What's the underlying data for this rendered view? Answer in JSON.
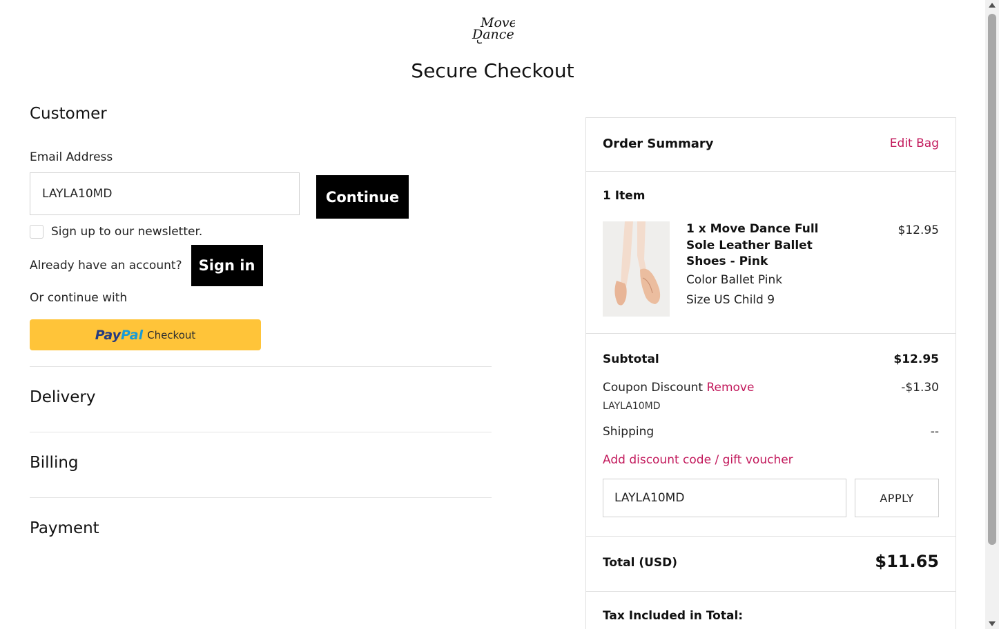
{
  "brand": {
    "logo_top": "Move",
    "logo_bottom": "Dance"
  },
  "page": {
    "title": "Secure Checkout"
  },
  "customer": {
    "heading": "Customer",
    "email_label": "Email Address",
    "email_value": "LAYLA10MD",
    "continue_label": "Continue",
    "newsletter_label": "Sign up to our newsletter.",
    "newsletter_checked": false,
    "account_prompt": "Already have an account?",
    "signin_label": "Sign in",
    "or_text": "Or continue with",
    "paypal": {
      "pay": "Pay",
      "pal": "Pal",
      "checkout": "Checkout",
      "bg_color": "#ffc439"
    }
  },
  "sections": [
    {
      "label": "Delivery"
    },
    {
      "label": "Billing"
    },
    {
      "label": "Payment"
    }
  ],
  "summary": {
    "title": "Order Summary",
    "edit_label": "Edit Bag",
    "item_count": "1 Item",
    "item": {
      "name": "1 x Move Dance Full Sole Leather Ballet Shoes - Pink",
      "color": "Color Ballet Pink",
      "size": "Size US Child 9",
      "price": "$12.95",
      "image_icon": "ballet-shoes-image"
    },
    "subtotal_label": "Subtotal",
    "subtotal_value": "$12.95",
    "coupon_label": "Coupon Discount",
    "coupon_remove": "Remove",
    "coupon_value": "-$1.30",
    "coupon_code": "LAYLA10MD",
    "shipping_label": "Shipping",
    "shipping_value": "--",
    "discount_link": "Add discount code / gift voucher",
    "code_input_value": "LAYLA10MD",
    "apply_label": "APPLY",
    "total_label": "Total (USD)",
    "total_value": "$11.65",
    "tax_label": "Tax Included in Total:"
  },
  "colors": {
    "accent_pink": "#c2185b",
    "button_black": "#000000",
    "border": "#e0e0e0"
  }
}
